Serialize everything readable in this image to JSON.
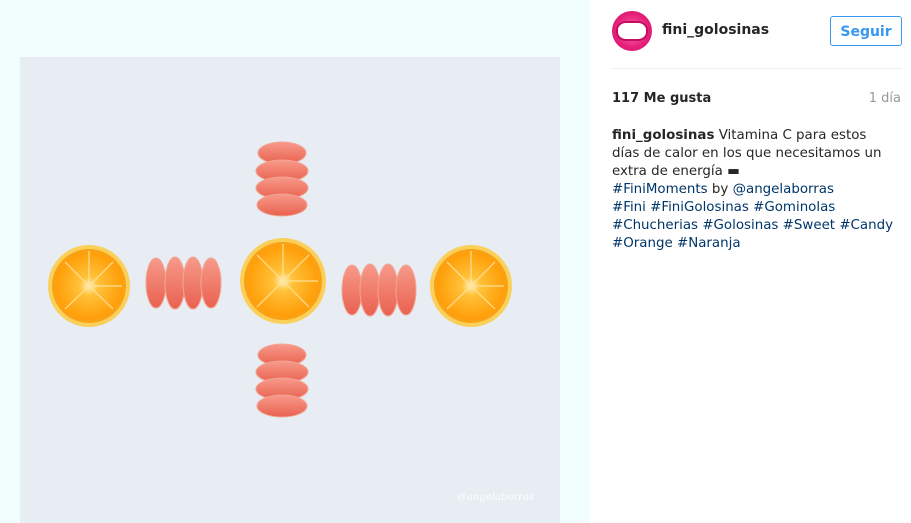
{
  "post": {
    "username": "fini_golosinas",
    "follow_label": "Seguir",
    "likes": "117 Me gusta",
    "time": "1 día",
    "caption_text": "Vitamina C para estos días de calor en los que necesitamos un extra de energía",
    "battery_glyph": "▬",
    "hashtag_fini_moments": "#FiniMoments",
    "by": "by",
    "mention": "@angelaborras",
    "hashtags": [
      "#Fini",
      "#FiniGolosinas",
      "#Gominolas",
      "#Chucherias",
      "#Golosinas",
      "#Sweet",
      "#Candy",
      "#Orange",
      "#Naranja"
    ]
  },
  "image": {
    "watermark": "@angelaborras",
    "colors": {
      "background": "#e7edf2",
      "orange_rind": "#f6a513",
      "orange_flesh": "#ffa712",
      "candy": "#f06f5e"
    }
  }
}
